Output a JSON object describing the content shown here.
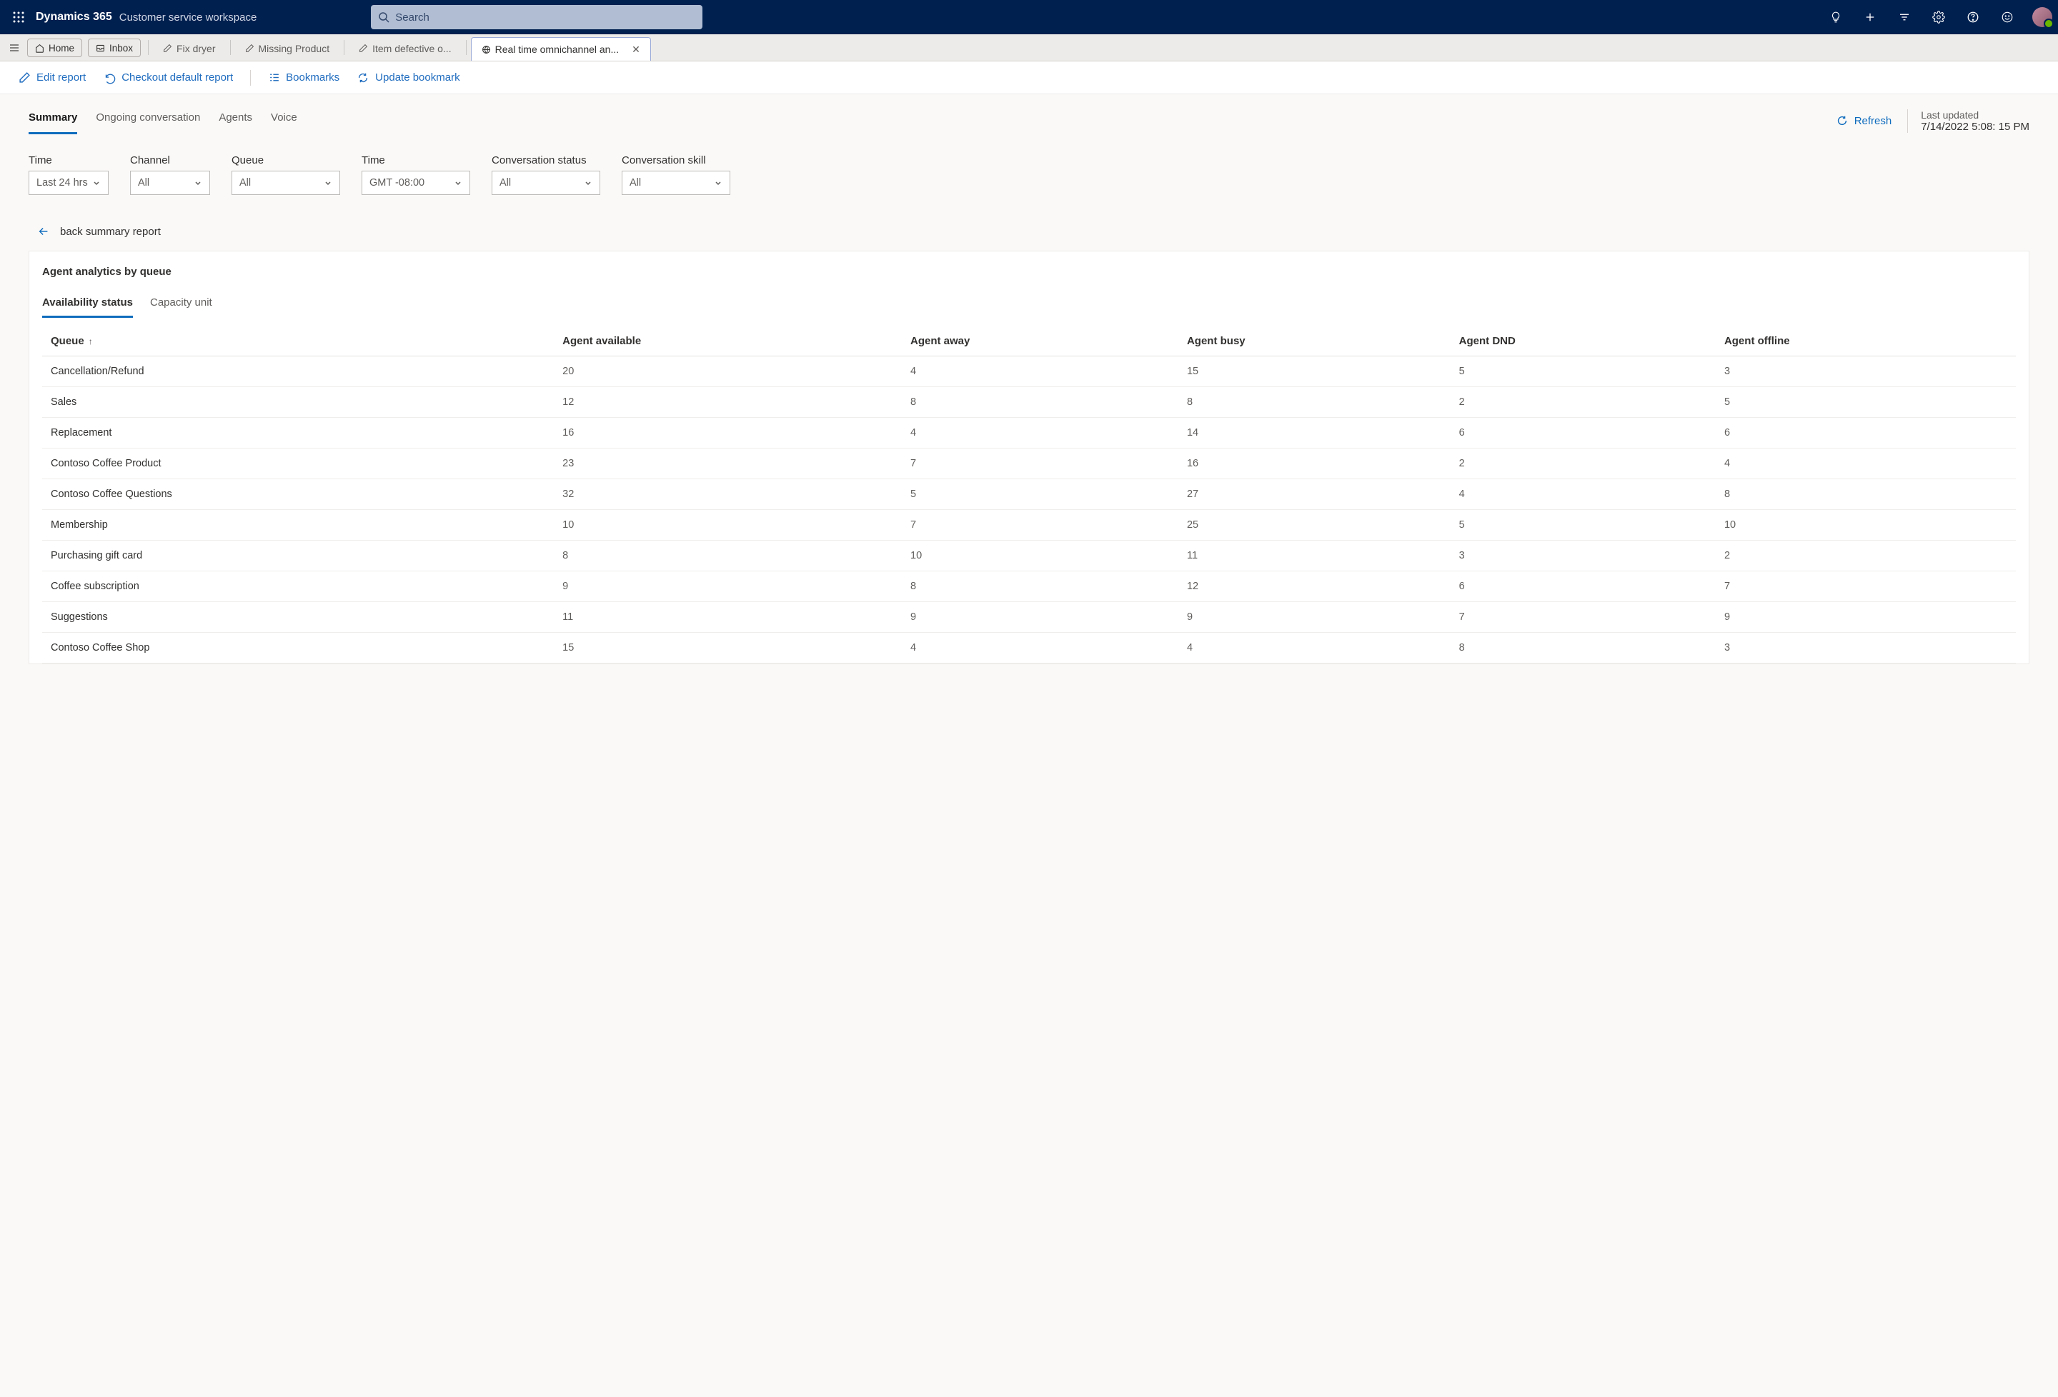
{
  "header": {
    "brand": "Dynamics 365",
    "sub": "Customer service workspace",
    "search_placeholder": "Search"
  },
  "tabstrip": {
    "home": "Home",
    "inbox": "Inbox",
    "tabs": [
      {
        "label": "Fix dryer"
      },
      {
        "label": "Missing Product"
      },
      {
        "label": "Item defective o..."
      },
      {
        "label": "Real time omnichannel an..."
      }
    ]
  },
  "cmdbar": {
    "edit": "Edit report",
    "checkout": "Checkout default report",
    "bookmarks": "Bookmarks",
    "update": "Update bookmark"
  },
  "report_tabs": [
    "Summary",
    "Ongoing conversation",
    "Agents",
    "Voice"
  ],
  "refresh_label": "Refresh",
  "last_updated_label": "Last updated",
  "last_updated_ts": "7/14/2022 5:08: 15 PM",
  "filters": [
    {
      "label": "Time",
      "value": "Last 24 hrs",
      "w": "narrow"
    },
    {
      "label": "Channel",
      "value": "All",
      "w": "narrow"
    },
    {
      "label": "Queue",
      "value": "All",
      "w": ""
    },
    {
      "label": "Time",
      "value": "GMT -08:00",
      "w": ""
    },
    {
      "label": "Conversation status",
      "value": "All",
      "w": ""
    },
    {
      "label": "Conversation skill",
      "value": "All",
      "w": ""
    }
  ],
  "backlink": "back summary report",
  "card_title": "Agent analytics by queue",
  "subtabs": [
    "Availability status",
    "Capacity unit"
  ],
  "columns": [
    "Queue",
    "Agent available",
    "Agent away",
    "Agent busy",
    "Agent DND",
    "Agent offline"
  ],
  "rows": [
    [
      "Cancellation/Refund",
      "20",
      "4",
      "15",
      "5",
      "3"
    ],
    [
      "Sales",
      "12",
      "8",
      "8",
      "2",
      "5"
    ],
    [
      "Replacement",
      "16",
      "4",
      "14",
      "6",
      "6"
    ],
    [
      "Contoso Coffee Product",
      "23",
      "7",
      "16",
      "2",
      "4"
    ],
    [
      "Contoso Coffee Questions",
      "32",
      "5",
      "27",
      "4",
      "8"
    ],
    [
      "Membership",
      "10",
      "7",
      "25",
      "5",
      "10"
    ],
    [
      "Purchasing gift card",
      "8",
      "10",
      "11",
      "3",
      "2"
    ],
    [
      "Coffee subscription",
      "9",
      "8",
      "12",
      "6",
      "7"
    ],
    [
      "Suggestions",
      "11",
      "9",
      "9",
      "7",
      "9"
    ],
    [
      "Contoso Coffee Shop",
      "15",
      "4",
      "4",
      "8",
      "3"
    ]
  ]
}
